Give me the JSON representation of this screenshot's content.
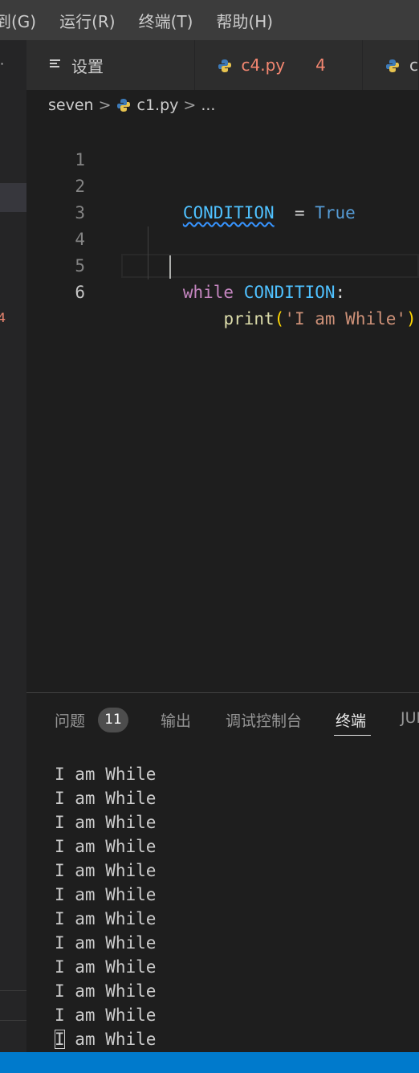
{
  "menubar": {
    "items": [
      {
        "label": "到(G)"
      },
      {
        "label": "运行(R)"
      },
      {
        "label": "终端(T)"
      },
      {
        "label": "帮助(H)"
      }
    ]
  },
  "sidebar": {
    "dot_glyph": "·",
    "problem_count": "4"
  },
  "tabs": [
    {
      "label": "设置",
      "icon": "settings-list-icon"
    },
    {
      "label": "c4.py",
      "icon": "python-icon",
      "badge": "4",
      "color": "#f48771"
    },
    {
      "label": "c",
      "icon": "python-icon"
    }
  ],
  "breadcrumb": {
    "folder": "seven",
    "file": "c1.py",
    "more": "..."
  },
  "editor": {
    "line_numbers": [
      "1",
      "2",
      "3",
      "4",
      "5",
      "6"
    ],
    "active_line": 6,
    "line1": {
      "name": "CONDITION",
      "op": "  = ",
      "value": "True"
    },
    "line4": {
      "kw": "while",
      "name": "CONDITION",
      "colon": ":"
    },
    "line5": {
      "indent": "    ",
      "fn": "print",
      "open": "(",
      "str": "'I am While'",
      "close": ")"
    }
  },
  "panel": {
    "tabs": {
      "problems": "问题",
      "problems_count": "11",
      "output": "输出",
      "debug_console": "调试控制台",
      "terminal": "终端",
      "jupyter": "JUI"
    },
    "active_tab": "终端",
    "terminal_lines": [
      "I am While",
      "I am While",
      "I am While",
      "I am While",
      "I am While",
      "I am While",
      "I am While",
      "I am While",
      "I am While",
      "I am While",
      "I am While"
    ],
    "last_line_first_char": "I",
    "last_line_rest": " am While"
  },
  "colors": {
    "accent": "#007acc",
    "error": "#f48771",
    "keyword": "#c586c0",
    "constant": "#4fc1ff",
    "string": "#ce9178"
  }
}
